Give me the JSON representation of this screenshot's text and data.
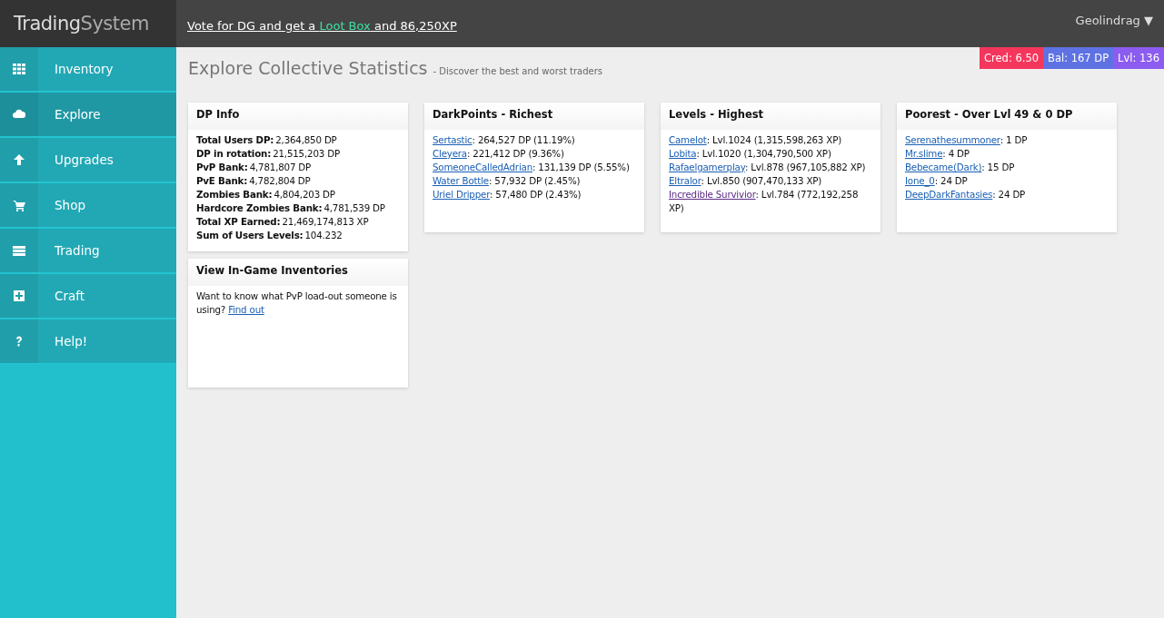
{
  "header": {
    "logo": {
      "part_1": "Trading",
      "part_2": "System"
    },
    "banner": {
      "prefix": "Vote for DG and get a ",
      "highlight": "Loot Box",
      "suffix": " and 86,250XP"
    },
    "user_menu": "Geolindrag ▼"
  },
  "sidebar": {
    "items": [
      {
        "label": "Inventory",
        "selected": false
      },
      {
        "label": "Explore",
        "selected": true
      },
      {
        "label": "Upgrades",
        "selected": false
      },
      {
        "label": "Shop",
        "selected": false
      },
      {
        "label": "Trading",
        "selected": false
      },
      {
        "label": "Craft",
        "selected": false
      },
      {
        "label": "Help!",
        "selected": false
      }
    ]
  },
  "page": {
    "title": "Explore Collective Statistics",
    "subtitle": "- Discover the best and worst traders"
  },
  "badges": [
    {
      "text": "Cred: 6.50",
      "color": "#f5365c"
    },
    {
      "text": "Bal: 167 DP",
      "color": "#5e72e4"
    },
    {
      "text": "Lvl: 136",
      "color": "#8c5cf0"
    }
  ],
  "cards": [
    {
      "kind": "stats",
      "title": "DP Info",
      "stats": [
        {
          "label": "Total Users DP:",
          "value": "2,364,850 DP"
        },
        {
          "label": "DP in rotation:",
          "value": "21,515,203 DP"
        },
        {
          "label": "PvP Bank:",
          "value": "4,781,807 DP"
        },
        {
          "label": "PvE Bank:",
          "value": "4,782,804 DP"
        },
        {
          "label": "Zombies Bank:",
          "value": "4,804,203 DP"
        },
        {
          "label": "Hardcore Zombies Bank:",
          "value": "4,781,539 DP"
        },
        {
          "label": "Total XP Earned:",
          "value": "21,469,174,813 XP"
        },
        {
          "label": "Sum of Users Levels:",
          "value": "104.232"
        }
      ]
    },
    {
      "kind": "ranking",
      "title": "DarkPoints - Richest",
      "entries": [
        {
          "name": "Sertastic",
          "text": ": 264,527 DP (11.19%)",
          "visited": false
        },
        {
          "name": "Cleyera",
          "text": ": 221,412 DP (9.36%)",
          "visited": false
        },
        {
          "name": "SomeoneCalledAdrian",
          "text": ": 131,139 DP (5.55%)",
          "visited": false
        },
        {
          "name": "Water Bottle",
          "text": ": 57,932 DP (2.45%)",
          "visited": false
        },
        {
          "name": "Uriel Dripper",
          "text": ": 57,480 DP (2.43%)",
          "visited": false
        }
      ]
    },
    {
      "kind": "ranking",
      "title": "Levels - Highest",
      "entries": [
        {
          "name": "Camelot",
          "text": ": Lvl.1024 (1,315,598,263 XP)",
          "visited": false
        },
        {
          "name": "Lobita",
          "text": ": Lvl.1020 (1,304,790,500 XP)",
          "visited": false
        },
        {
          "name": "Rafaelgamerplay",
          "text": ": Lvl.878 (967,105,882 XP)",
          "visited": false
        },
        {
          "name": "Eltralor",
          "text": ": Lvl.850 (907,470,133 XP)",
          "visited": false
        },
        {
          "name": "Incredible Survivior",
          "text": ": Lvl.784 (772,192,258 XP)",
          "visited": true
        }
      ]
    },
    {
      "kind": "ranking",
      "title": "Poorest - Over Lvl 49 & 0 DP",
      "entries": [
        {
          "name": "Serenathesummoner",
          "text": ": 1 DP",
          "visited": false
        },
        {
          "name": "Mr.slime",
          "text": ": 4 DP",
          "visited": false
        },
        {
          "name": "Bebecame(Dark)",
          "text": ": 15 DP",
          "visited": false
        },
        {
          "name": "Ione_0",
          "text": ": 24 DP",
          "visited": false
        },
        {
          "name": "DeepDarkFantasies",
          "text": ": 24 DP",
          "visited": false
        }
      ]
    },
    {
      "kind": "info",
      "title": "View In-Game Inventories",
      "text": "Want to know what PvP load-out someone is using?",
      "link": "Find out"
    }
  ]
}
